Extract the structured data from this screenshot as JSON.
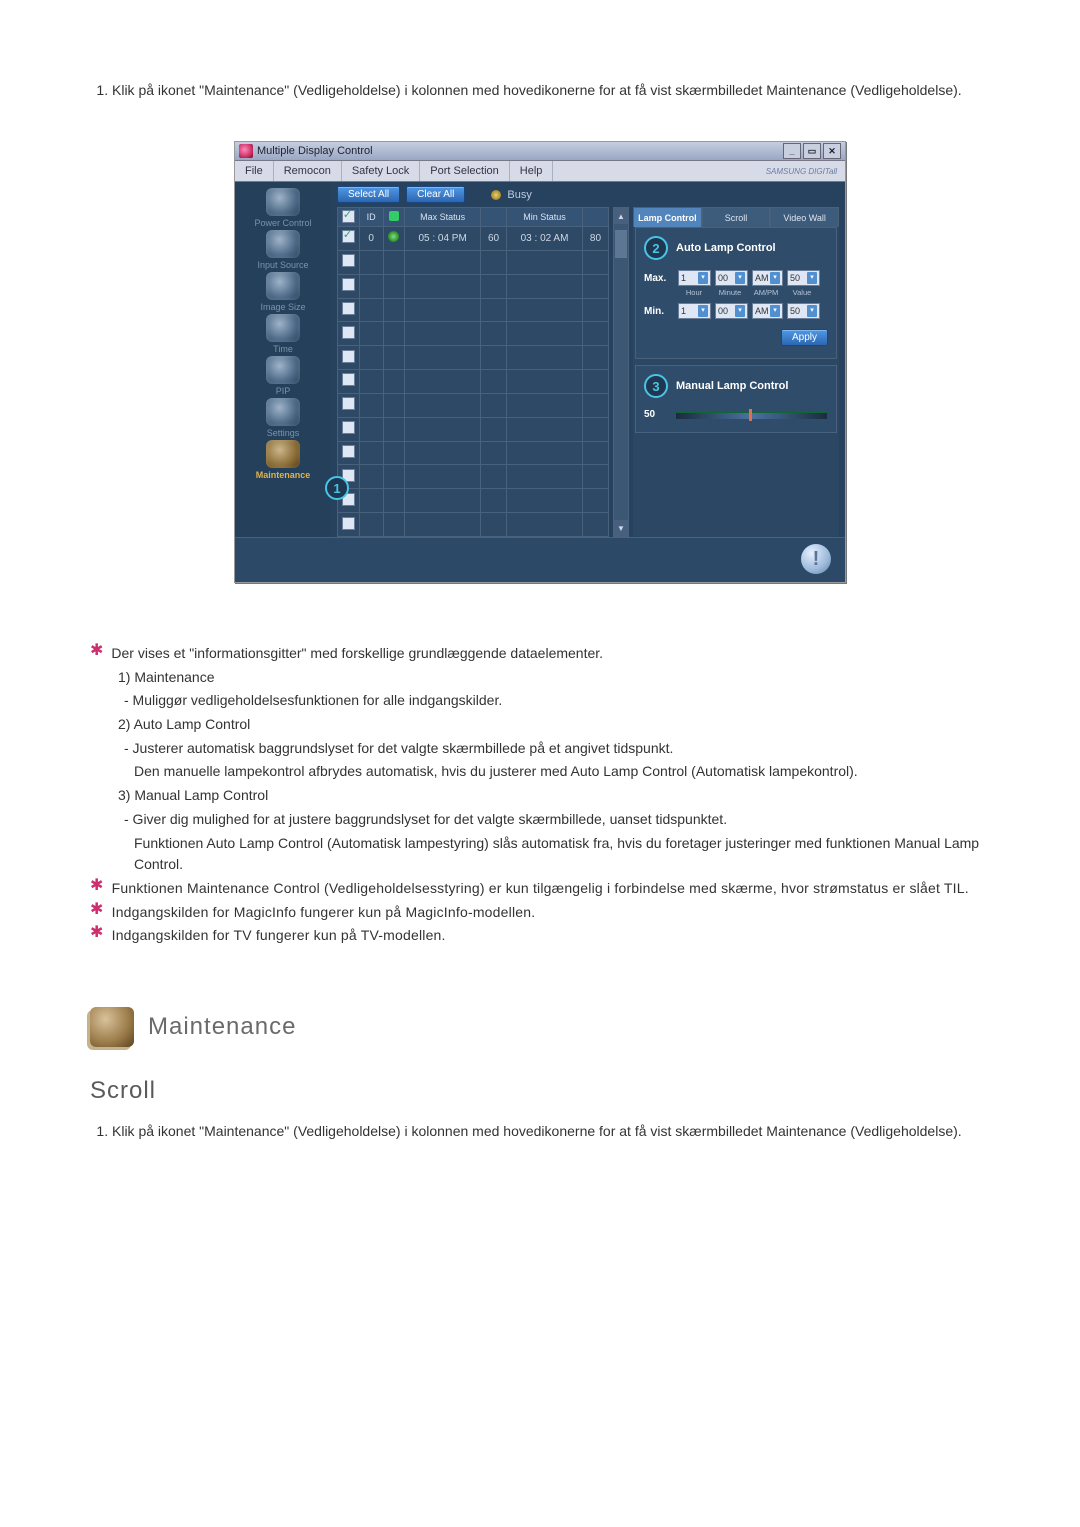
{
  "instructions_top": "Klik på ikonet \"Maintenance\" (Vedligeholdelse) i kolonnen med hovedikonerne for at få vist skærmbilledet Maintenance (Vedligeholdelse).",
  "app": {
    "title": "Multiple Display Control",
    "winbtns": {
      "min": "_",
      "max": "▭",
      "close": "✕"
    },
    "menu": [
      "File",
      "Remocon",
      "Safety Lock",
      "Port Selection",
      "Help"
    ],
    "brand": "SAMSUNG DIGITall",
    "sidebar": [
      {
        "label": "Power Control"
      },
      {
        "label": "Input Source"
      },
      {
        "label": "Image Size"
      },
      {
        "label": "Time"
      },
      {
        "label": "PIP"
      },
      {
        "label": "Settings"
      },
      {
        "label": "Maintenance"
      }
    ],
    "toolbar": {
      "select_all": "Select All",
      "clear_all": "Clear All",
      "busy": "Busy"
    },
    "grid": {
      "headers": {
        "chk": "☑",
        "id": "ID",
        "pwr": "",
        "maxstatus": "Max Status",
        "maxval": "",
        "minstatus": "Min Status",
        "minval": ""
      },
      "rows": [
        {
          "chk": true,
          "id": "0",
          "power": "on",
          "maxstatus": "05 : 04 PM",
          "maxval": "60",
          "minstatus": "03 : 02 AM",
          "minval": "80"
        },
        {
          "chk": false,
          "id": "",
          "power": "",
          "maxstatus": "",
          "maxval": "",
          "minstatus": "",
          "minval": ""
        },
        {
          "chk": false,
          "id": "",
          "power": "",
          "maxstatus": "",
          "maxval": "",
          "minstatus": "",
          "minval": ""
        },
        {
          "chk": false,
          "id": "",
          "power": "",
          "maxstatus": "",
          "maxval": "",
          "minstatus": "",
          "minval": ""
        },
        {
          "chk": false,
          "id": "",
          "power": "",
          "maxstatus": "",
          "maxval": "",
          "minstatus": "",
          "minval": ""
        },
        {
          "chk": false,
          "id": "",
          "power": "",
          "maxstatus": "",
          "maxval": "",
          "minstatus": "",
          "minval": ""
        },
        {
          "chk": false,
          "id": "",
          "power": "",
          "maxstatus": "",
          "maxval": "",
          "minstatus": "",
          "minval": ""
        },
        {
          "chk": false,
          "id": "",
          "power": "",
          "maxstatus": "",
          "maxval": "",
          "minstatus": "",
          "minval": ""
        },
        {
          "chk": false,
          "id": "",
          "power": "",
          "maxstatus": "",
          "maxval": "",
          "minstatus": "",
          "minval": ""
        },
        {
          "chk": false,
          "id": "",
          "power": "",
          "maxstatus": "",
          "maxval": "",
          "minstatus": "",
          "minval": ""
        },
        {
          "chk": false,
          "id": "",
          "power": "",
          "maxstatus": "",
          "maxval": "",
          "minstatus": "",
          "minval": ""
        },
        {
          "chk": false,
          "id": "",
          "power": "",
          "maxstatus": "",
          "maxval": "",
          "minstatus": "",
          "minval": ""
        },
        {
          "chk": false,
          "id": "",
          "power": "",
          "maxstatus": "",
          "maxval": "",
          "minstatus": "",
          "minval": ""
        }
      ]
    },
    "right": {
      "tabs": [
        "Lamp Control",
        "Scroll",
        "Video Wall"
      ],
      "auto": {
        "title": "Auto Lamp Control",
        "num": "2",
        "max_label": "Max.",
        "min_label": "Min.",
        "cols": [
          "Hour",
          "Minute",
          "AM/PM",
          "Value"
        ],
        "max": {
          "hour": "1",
          "min": "00",
          "ampm": "AM",
          "val": "50"
        },
        "min": {
          "hour": "1",
          "min": "00",
          "ampm": "AM",
          "val": "50"
        },
        "apply": "Apply"
      },
      "manual": {
        "title": "Manual Lamp Control",
        "num": "3",
        "value_label": "50"
      }
    },
    "overlay1": "1"
  },
  "doc": {
    "star_line1": "Der vises et \"informationsgitter\" med forskellige grundlæggende dataelementer.",
    "item1_head": "1)  Maintenance",
    "item1_body": "- Muliggør vedligeholdelsesfunktionen for alle indgangskilder.",
    "item2_head": "2)  Auto Lamp Control",
    "item2_body1": "- Justerer automatisk baggrundslyset for det valgte skærmbillede på et angivet tidspunkt.",
    "item2_body2": "Den manuelle lampekontrol afbrydes automatisk, hvis du justerer med Auto Lamp Control (Automatisk lampekontrol).",
    "item3_head": "3)  Manual Lamp Control",
    "item3_body1": "- Giver dig mulighed for at justere baggrundslyset for det valgte skærmbillede, uanset tidspunktet.",
    "item3_body2": "Funktionen Auto Lamp Control (Automatisk lampestyring) slås automatisk fra, hvis du foretager justeringer med funktionen Manual Lamp Control.",
    "star_line2": "Funktionen Maintenance Control (Vedligeholdelsesstyring) er kun tilgængelig i forbindelse med skærme, hvor strømstatus er slået TIL.",
    "star_line3": "Indgangskilden for MagicInfo fungerer kun på MagicInfo-modellen.",
    "star_line4": "Indgangskilden for TV fungerer kun på TV-modellen."
  },
  "section": {
    "title": "Maintenance",
    "sub": "Scroll"
  },
  "instructions_bottom": "Klik på ikonet \"Maintenance\" (Vedligeholdelse) i kolonnen med hovedikonerne for at få vist skærmbilledet Maintenance (Vedligeholdelse)."
}
